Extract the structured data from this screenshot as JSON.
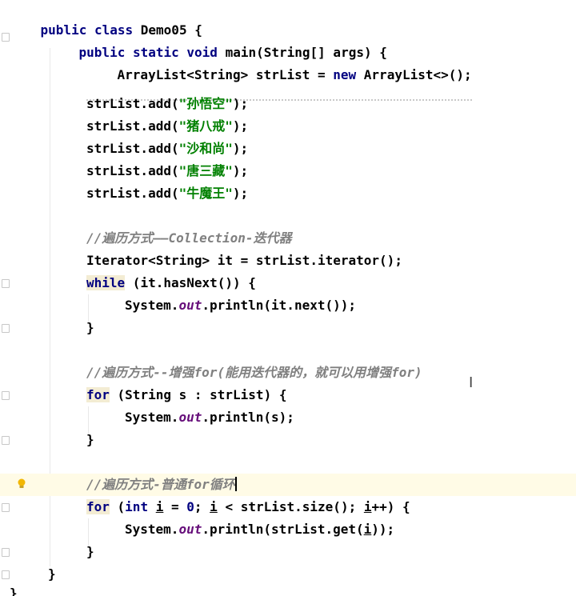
{
  "editor": {
    "lines": {
      "l01": {
        "a": "public",
        "b": " ",
        "c": "class",
        "d": " Demo05 {"
      },
      "l02": {
        "a": "public",
        "b": " ",
        "c": "static",
        "d": " ",
        "e": "void",
        "f": " main(String[] args) {"
      },
      "l03": {
        "a": "ArrayList<String> strList = ",
        "b": "new",
        "c": " ArrayList<>();"
      },
      "l05": {
        "a": "strList.add(",
        "b": "\"孙悟空\"",
        "c": ");"
      },
      "l06": {
        "a": "strList.add(",
        "b": "\"猪八戒\"",
        "c": ");"
      },
      "l07": {
        "a": "strList.add(",
        "b": "\"沙和尚\"",
        "c": ");"
      },
      "l08": {
        "a": "strList.add(",
        "b": "\"唐三藏\"",
        "c": ");"
      },
      "l09": {
        "a": "strList.add(",
        "b": "\"牛魔王\"",
        "c": ");"
      },
      "l11": {
        "a": "//遍历方式——Collection-迭代器"
      },
      "l12": {
        "a": "Iterator<String> it = strList.iterator();"
      },
      "l13": {
        "a": "while",
        "b": " (it.hasNext()) {"
      },
      "l14": {
        "a": "System.",
        "b": "out",
        "c": ".println(it.next());"
      },
      "l15": {
        "a": "}"
      },
      "l17": {
        "a": "//遍历方式--增强for(能用迭代器的，就可以用增强for)"
      },
      "l18": {
        "a": "for",
        "b": " (String s : strList) {"
      },
      "l19": {
        "a": "System.",
        "b": "out",
        "c": ".println(s);"
      },
      "l20": {
        "a": "}"
      },
      "l22": {
        "a": "//遍历方式-普通for循环"
      },
      "l23": {
        "a": "for",
        "b": " (",
        "c": "int",
        "d": " ",
        "e": "i",
        "f": " = ",
        "g": "0",
        "h": "; ",
        "i": "i",
        "j": " < strList.size(); ",
        "k": "i",
        "l": "++) {"
      },
      "l24": {
        "a": "System.",
        "b": "out",
        "c": ".println(strList.get(",
        "d": "i",
        "e": "));"
      },
      "l25": {
        "a": "}"
      },
      "l26": {
        "a": "}"
      },
      "l27": {
        "a": "}"
      }
    },
    "icons": {
      "fold": "fold-marker-icon",
      "bulb": "lightbulb-icon",
      "cursor": "text-cursor-icon"
    },
    "colors": {
      "keyword": "#000080",
      "string": "#008000",
      "field": "#660e7a",
      "comment": "#808080",
      "current_line": "#fffbe6"
    }
  }
}
